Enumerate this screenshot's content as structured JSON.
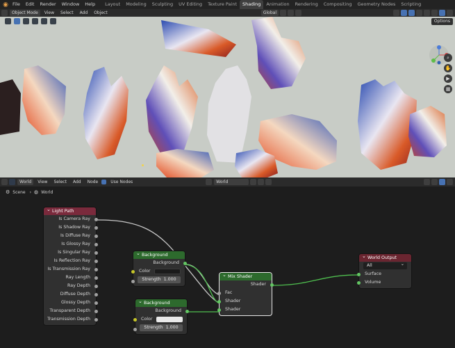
{
  "topbar": {
    "menu": [
      "File",
      "Edit",
      "Render",
      "Window",
      "Help"
    ],
    "workspaces": [
      "Layout",
      "Modeling",
      "Sculpting",
      "UV Editing",
      "Texture Paint",
      "Shading",
      "Animation",
      "Rendering",
      "Compositing",
      "Geometry Nodes",
      "Scripting"
    ],
    "active_workspace": "Shading"
  },
  "viewport_header": {
    "mode": "Object Mode",
    "menu": [
      "View",
      "Select",
      "Add",
      "Object"
    ],
    "transform_orientation": "Global",
    "options_label": "Options"
  },
  "node_editor_header": {
    "shader_type": "World",
    "menu": [
      "View",
      "Select",
      "Add",
      "Node"
    ],
    "use_nodes_label": "Use Nodes",
    "world_name": "World"
  },
  "breadcrumb": {
    "scene": "Scene",
    "world": "World"
  },
  "nodes": {
    "light_path": {
      "title": "Light Path",
      "outputs": [
        "Is Camera Ray",
        "Is Shadow Ray",
        "Is Diffuse Ray",
        "Is Glossy Ray",
        "Is Singular Ray",
        "Is Reflection Ray",
        "Is Transmission Ray",
        "Ray Length",
        "Ray Depth",
        "Diffuse Depth",
        "Glossy Depth",
        "Transparent Depth",
        "Transmission Depth"
      ]
    },
    "background_1": {
      "title": "Background",
      "output": "Background",
      "color_label": "Color",
      "strength_label": "Strength",
      "strength_value": "1.000",
      "color_hex": "#1b1b1b"
    },
    "background_2": {
      "title": "Background",
      "output": "Background",
      "color_label": "Color",
      "strength_label": "Strength",
      "strength_value": "1.000",
      "color_hex": "#e9e9e9"
    },
    "mix_shader": {
      "title": "Mix Shader",
      "output": "Shader",
      "inputs": [
        "Fac",
        "Shader",
        "Shader"
      ]
    },
    "world_output": {
      "title": "World Output",
      "target": "All",
      "inputs": [
        "Surface",
        "Volume"
      ]
    }
  },
  "colors": {
    "light_path_header": "#7a2a3c",
    "shader_header": "#2d6a2d",
    "output_header": "#6a2530",
    "active_tab": "#3f3f3f",
    "viewport_bg": "#c8ccc6"
  }
}
